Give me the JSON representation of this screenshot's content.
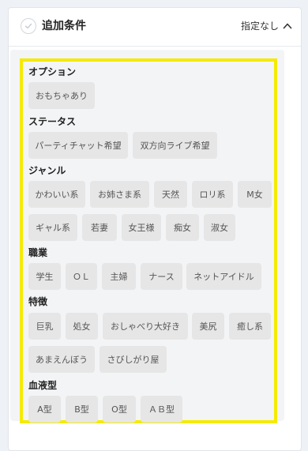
{
  "panel": {
    "title": "追加条件",
    "toggle_label": "指定なし",
    "colors": {
      "frame_border": "#f5ea00",
      "chip_bg": "#e6e6e6",
      "inner_bg": "#f3f4f6"
    },
    "icons": {
      "check": "check-circle-icon",
      "toggle": "chevron-up-icon"
    }
  },
  "sections": {
    "option": {
      "label": "オプション",
      "tags": [
        "おもちゃあり"
      ]
    },
    "status": {
      "label": "ステータス",
      "tags": [
        "パーティチャット希望",
        "双方向ライブ希望"
      ]
    },
    "genre": {
      "label": "ジャンル",
      "tags": [
        "かわいい系",
        "お姉さま系",
        "天然",
        "ロリ系",
        "M女",
        "ギャル系",
        "若妻",
        "女王様",
        "痴女",
        "淑女"
      ]
    },
    "job": {
      "label": "職業",
      "tags": [
        "学生",
        "ＯＬ",
        "主婦",
        "ナース",
        "ネットアイドル"
      ]
    },
    "trait": {
      "label": "特徴",
      "tags": [
        "巨乳",
        "処女",
        "おしゃべり大好き",
        "美尻",
        "癒し系",
        "あまえんぼう",
        "さびしがり屋"
      ]
    },
    "blood": {
      "label": "血液型",
      "tags": [
        "A型",
        "B型",
        "O型",
        "ＡＢ型"
      ]
    }
  }
}
